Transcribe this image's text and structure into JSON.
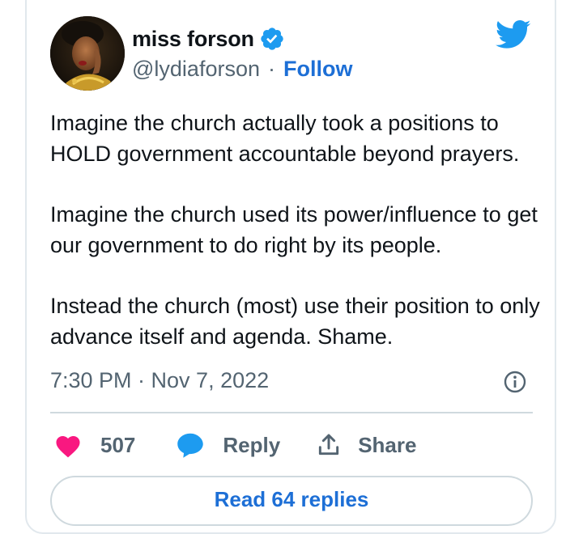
{
  "author": {
    "name": "miss forson",
    "handle": "@lydiaforson",
    "separator": "·",
    "follow_label": "Follow",
    "verified": true
  },
  "tweet": {
    "paragraphs": [
      "Imagine the church actually took a positions to HOLD government accountable beyond prayers.",
      "Imagine the church used its power/influence to get our government to do right by its people.",
      "Instead the church (most) use their position to only advance itself and agenda. Shame."
    ],
    "timestamp": "7:30 PM · Nov 7, 2022"
  },
  "actions": {
    "like_count": "507",
    "reply_label": "Reply",
    "share_label": "Share"
  },
  "read_replies_label": "Read 64 replies",
  "icons": {
    "brand": "twitter-bird-icon",
    "verified": "verified-badge-icon",
    "info": "info-icon",
    "like": "heart-icon",
    "reply": "reply-bubble-icon",
    "share": "share-icon"
  },
  "colors": {
    "accent": "#1d9bf0",
    "link": "#1d6fd6",
    "like": "#f91880",
    "text": "#0f1419",
    "muted": "#536471",
    "border": "#cfd9de"
  }
}
